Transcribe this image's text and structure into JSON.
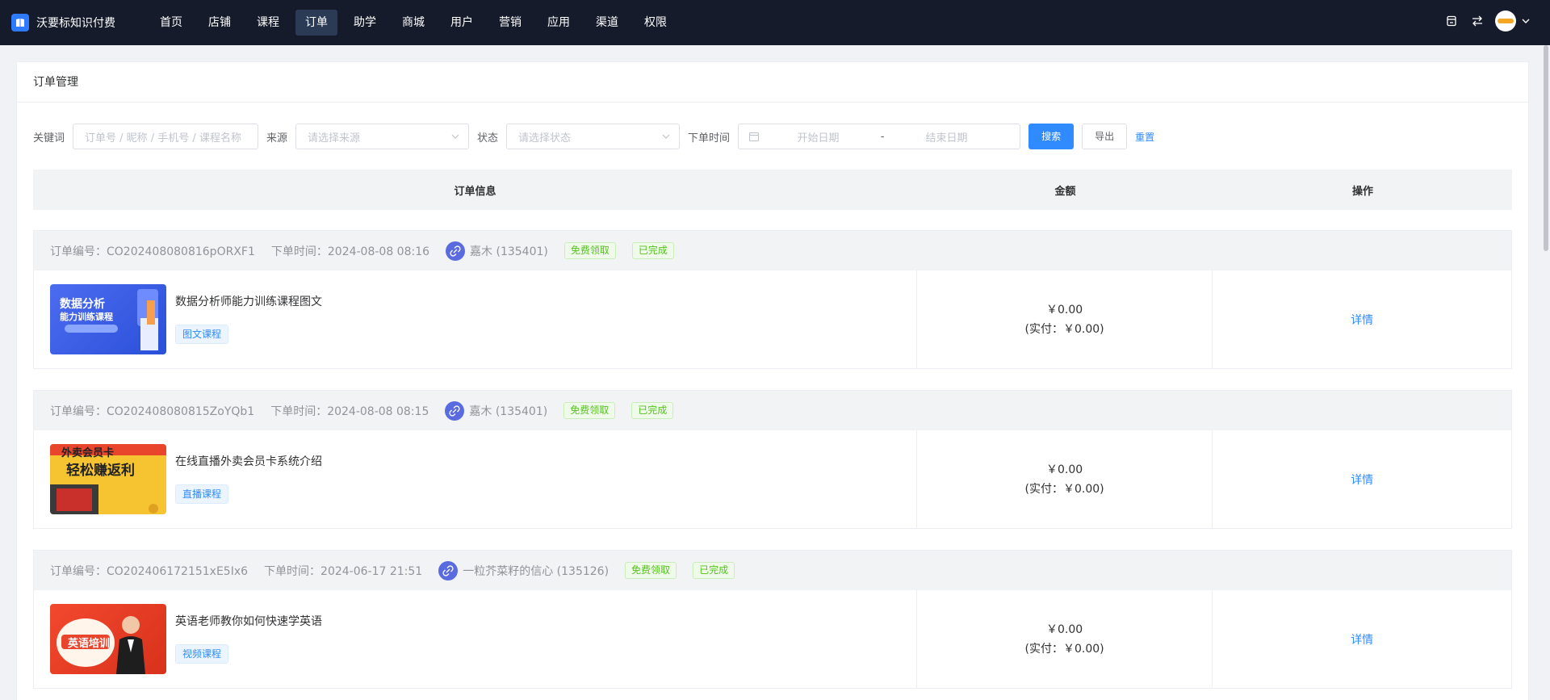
{
  "brand": {
    "name": "沃要标知识付费"
  },
  "nav": [
    {
      "label": "首页",
      "active": false
    },
    {
      "label": "店铺",
      "active": false
    },
    {
      "label": "课程",
      "active": false
    },
    {
      "label": "订单",
      "active": true
    },
    {
      "label": "助学",
      "active": false
    },
    {
      "label": "商城",
      "active": false
    },
    {
      "label": "用户",
      "active": false
    },
    {
      "label": "营销",
      "active": false
    },
    {
      "label": "应用",
      "active": false
    },
    {
      "label": "渠道",
      "active": false
    },
    {
      "label": "权限",
      "active": false
    }
  ],
  "page": {
    "title": "订单管理"
  },
  "filters": {
    "keyword_label": "关键词",
    "keyword_placeholder": "订单号 / 昵称 / 手机号 / 课程名称",
    "source_label": "来源",
    "source_placeholder": "请选择来源",
    "status_label": "状态",
    "status_placeholder": "请选择状态",
    "time_label": "下单时间",
    "start_placeholder": "开始日期",
    "date_separator": "-",
    "end_placeholder": "结束日期",
    "search_label": "搜索",
    "export_label": "导出",
    "reset_label": "重置"
  },
  "table": {
    "col_info": "订单信息",
    "col_amount": "金额",
    "col_ops": "操作"
  },
  "orders": [
    {
      "no_label": "订单编号：CO202408080816pORXF1",
      "time_label": "下单时间：2024-08-08 08:16",
      "user": "嘉木 (135401)",
      "tag_free": "免费领取",
      "tag_status": "已完成",
      "course_title": "数据分析师能力训练课程图文",
      "course_type": "图文课程",
      "amount": "￥0.00",
      "paid": "(实付：￥0.00)",
      "detail": "详情",
      "thumb_text1": "数据分析",
      "thumb_text2": "能力训练课程"
    },
    {
      "no_label": "订单编号：CO202408080815ZoYQb1",
      "time_label": "下单时间：2024-08-08 08:15",
      "user": "嘉木 (135401)",
      "tag_free": "免费领取",
      "tag_status": "已完成",
      "course_title": "在线直播外卖会员卡系统介绍",
      "course_type": "直播课程",
      "amount": "￥0.00",
      "paid": "(实付：￥0.00)",
      "detail": "详情",
      "thumb_text1": "外卖会员卡",
      "thumb_text2": "轻松赚返利"
    },
    {
      "no_label": "订单编号：CO202406172151xE5Ix6",
      "time_label": "下单时间：2024-06-17 21:51",
      "user": "一粒芥菜籽的信心 (135126)",
      "tag_free": "免费领取",
      "tag_status": "已完成",
      "course_title": "英语老师教你如何快速学英语",
      "course_type": "视频课程",
      "amount": "￥0.00",
      "paid": "(实付：￥0.00)",
      "detail": "详情",
      "thumb_text1": "英语培训",
      "thumb_text2": ""
    }
  ]
}
